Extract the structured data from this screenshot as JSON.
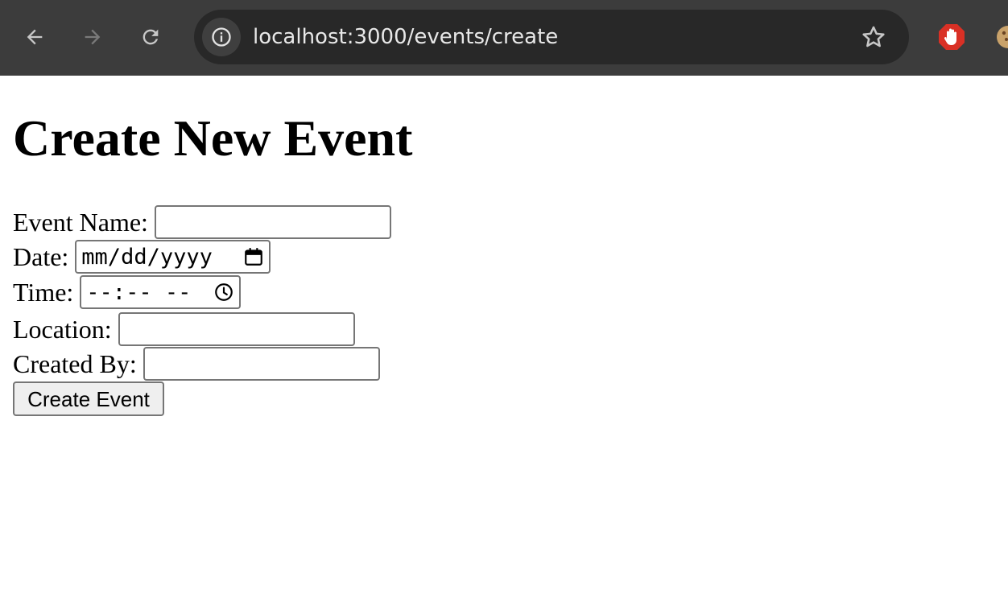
{
  "browser": {
    "url": "localhost:3000/events/create"
  },
  "page": {
    "title": "Create New Event",
    "form": {
      "event_name_label": "Event Name:",
      "event_name_value": "",
      "date_label": "Date:",
      "date_placeholder": "mm/dd/yyyy",
      "time_label": "Time:",
      "time_placeholder": "--:-- --",
      "location_label": "Location:",
      "location_value": "",
      "created_by_label": "Created By:",
      "created_by_value": "",
      "submit_label": "Create Event"
    }
  },
  "colors": {
    "chrome_bg": "#3c3c3c",
    "omnibox_bg": "#282828",
    "input_border": "#767676",
    "button_bg": "#efefef",
    "adblock_red": "#d93025"
  },
  "icons": {
    "back": "arrow-left-icon",
    "forward": "arrow-right-icon",
    "reload": "reload-icon",
    "site_info": "info-icon",
    "bookmark": "star-icon",
    "extension_1": "adblock-hand-icon",
    "extension_2": "cookie-icon",
    "date_picker": "calendar-icon",
    "time_picker": "clock-icon"
  }
}
